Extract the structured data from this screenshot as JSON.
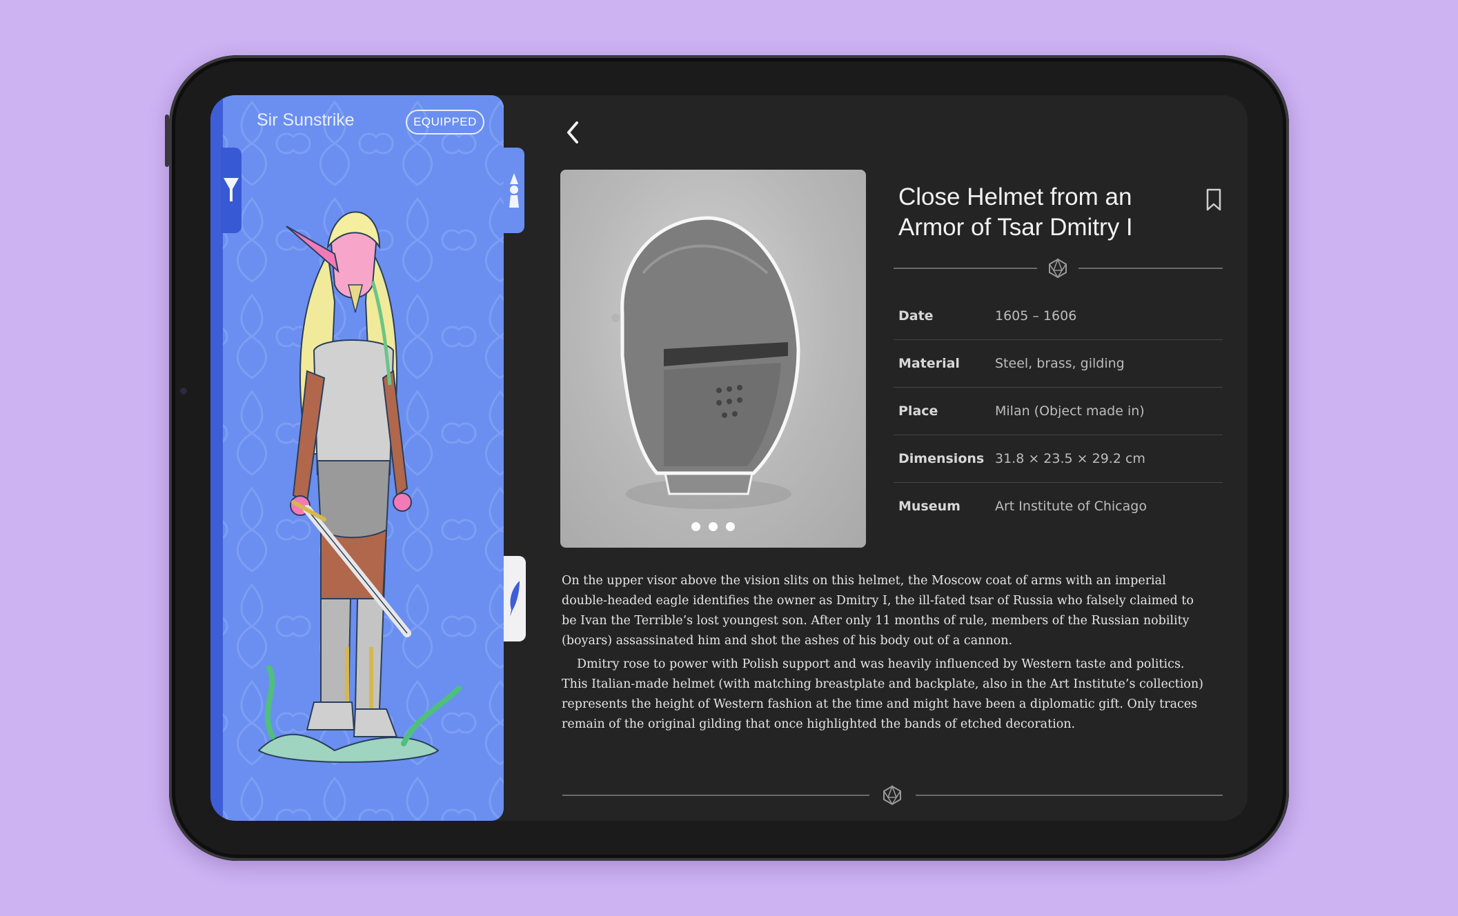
{
  "character": {
    "name": "Sir Sunstrike",
    "status_badge": "EQUIPPED",
    "tabs": [
      {
        "icon": "goblet-icon"
      },
      {
        "icon": "pawn-icon"
      },
      {
        "icon": "quill-icon"
      }
    ]
  },
  "artifact": {
    "title": "Close Helmet from an Armor of Tsar Dmitry I",
    "image_count": 3,
    "details": [
      {
        "label": "Date",
        "value": "1605 – 1606"
      },
      {
        "label": "Material",
        "value": "Steel, brass, gilding"
      },
      {
        "label": "Place",
        "value": "Milan (Object made in)"
      },
      {
        "label": "Dimensions",
        "value": "31.8 × 23.5 × 29.2 cm"
      },
      {
        "label": "Museum",
        "value": "Art Institute of Chicago"
      }
    ],
    "description": [
      "On the upper visor above the vision slits on this helmet, the Moscow coat of arms with an imperial double-headed eagle identifies the owner as Dmitry I, the ill-fated tsar of Russia who falsely claimed to be Ivan the Terrible’s lost youngest son. After only 11 months of rule, members of the Russian nobility (boyars) assassinated him and shot the ashes of his body out of a cannon.",
      "Dmitry rose to power with Polish support and was heavily influenced by Western taste and politics. This Italian-made helmet (with matching breastplate and backplate, also in the Art Institute’s collection) represents the height of Western fashion at the time and might have been a diplomatic gift. Only traces remain of the original gilding that once highlighted the bands of etched decoration."
    ]
  },
  "colors": {
    "background": "#cdb3f2",
    "card_blue": "#6a8ff0",
    "card_dark_blue": "#3759d3",
    "panel_dark": "#242424"
  }
}
